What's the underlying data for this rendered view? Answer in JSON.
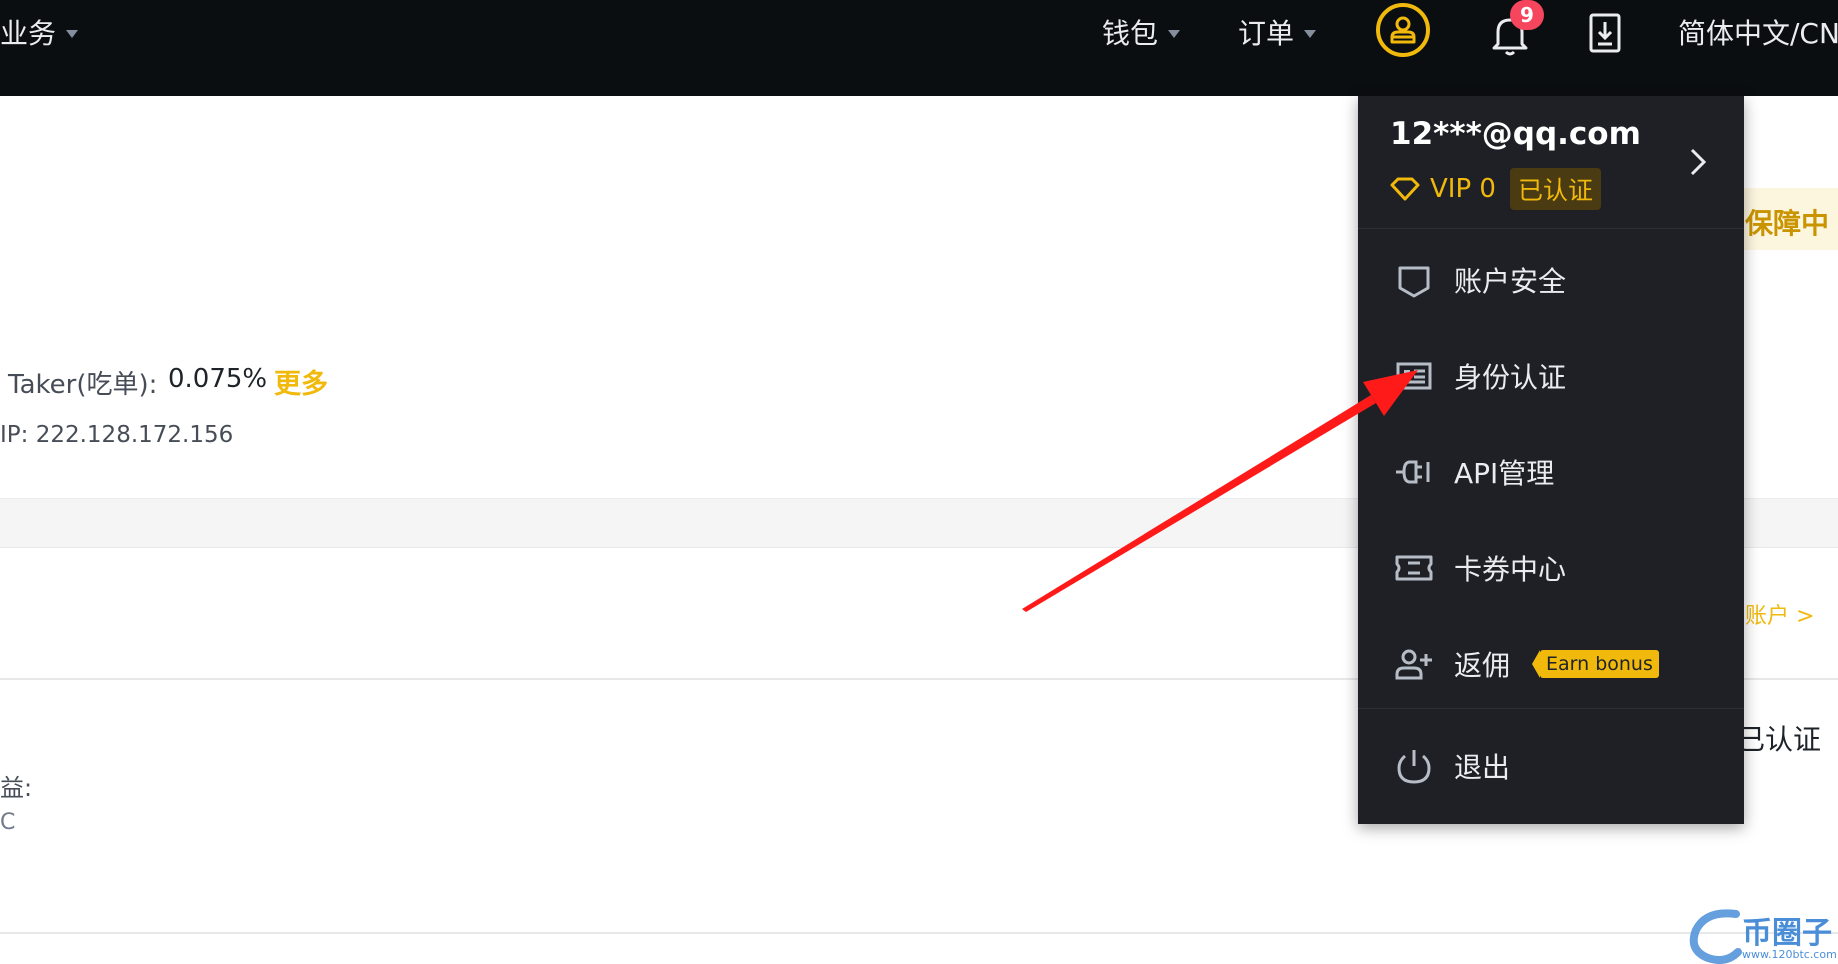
{
  "nav": {
    "business_fragment": "业务",
    "wallet_label": "钱包",
    "orders_label": "订单",
    "notification_count": "9",
    "language_label": "简体中文/CN",
    "accent_color": "#f0b90b"
  },
  "account_info": {
    "fee_label": "Taker(吃单):",
    "fee_value": "0.075%",
    "more_link": "更多",
    "ip_text": "IP: 222.128.172.156",
    "left_fragment_1": "益:",
    "left_fragment_2": "C",
    "right_fragment_1": "保障中",
    "right_fragment_2": "账户 >",
    "right_fragment_3": "已认证"
  },
  "dropdown": {
    "email": "12***@qq.com",
    "vip_level": "VIP 0",
    "verified_badge": "已认证",
    "items": [
      {
        "label": "账户安全",
        "icon": "shield-icon"
      },
      {
        "label": "身份认证",
        "icon": "id-card-icon"
      },
      {
        "label": "API管理",
        "icon": "api-plug-icon"
      },
      {
        "label": "卡券中心",
        "icon": "ticket-icon"
      },
      {
        "label": "返佣",
        "icon": "add-user-icon",
        "badge": "Earn bonus"
      },
      {
        "label": "退出",
        "icon": "power-icon"
      }
    ]
  },
  "watermark": {
    "brand": "币圈子",
    "url": "www.120btc.com"
  }
}
